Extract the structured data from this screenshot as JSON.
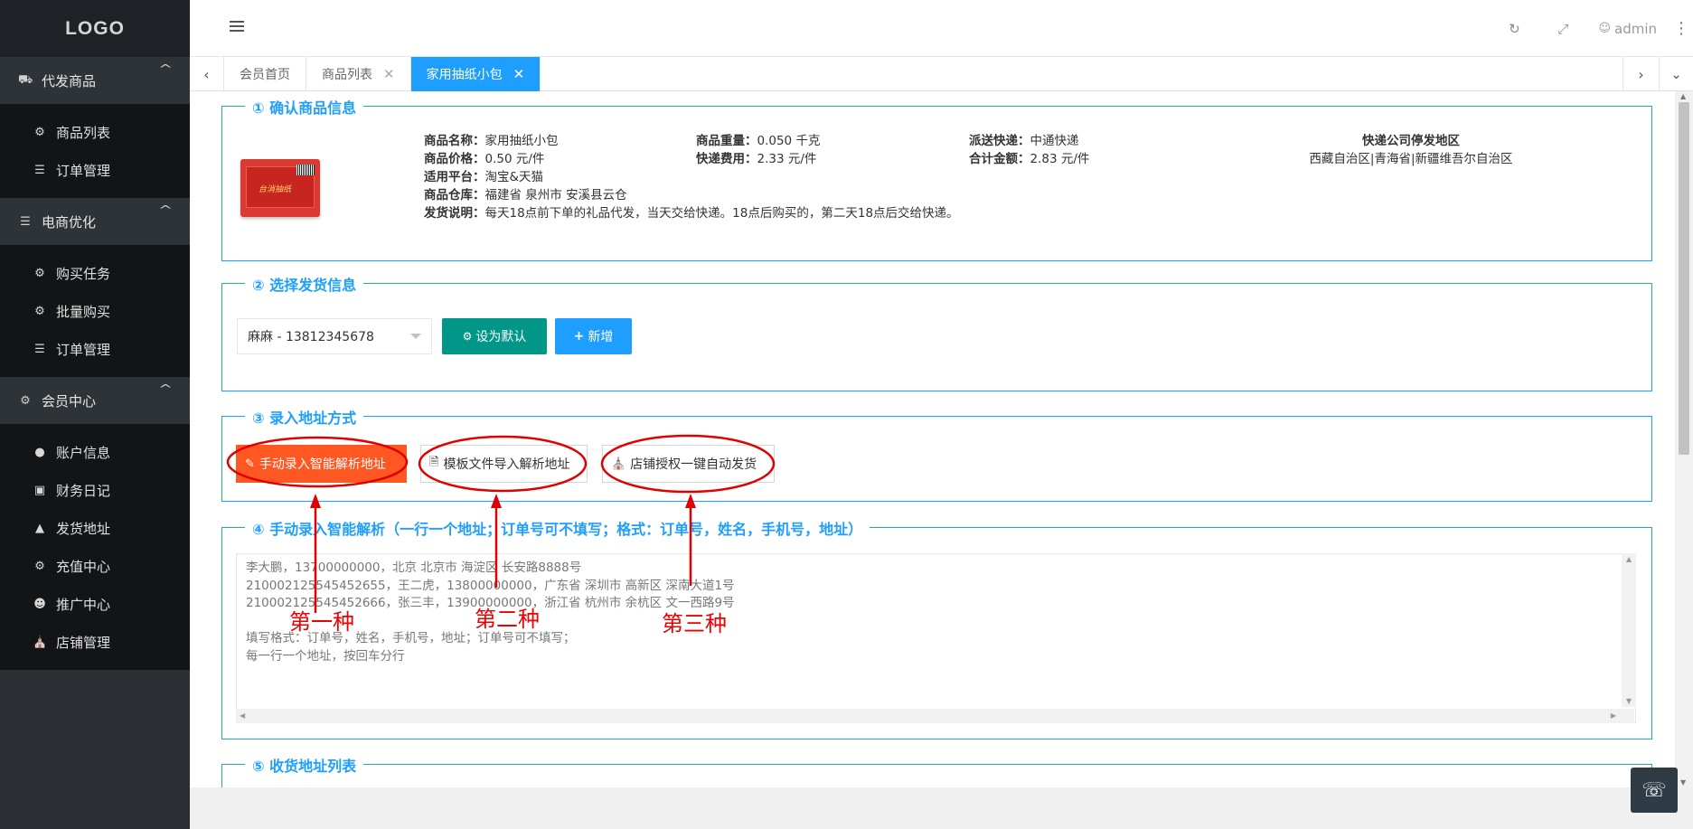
{
  "logo": "LOGO",
  "topbar": {
    "user": "admin"
  },
  "sidebar": {
    "groups": [
      {
        "label": "代发商品",
        "items": [
          {
            "label": "商品列表"
          },
          {
            "label": "订单管理"
          }
        ]
      },
      {
        "label": "电商优化",
        "items": [
          {
            "label": "购买任务"
          },
          {
            "label": "批量购买"
          },
          {
            "label": "订单管理"
          }
        ]
      },
      {
        "label": "会员中心",
        "items": [
          {
            "label": "账户信息"
          },
          {
            "label": "财务日记"
          },
          {
            "label": "发货地址"
          },
          {
            "label": "充值中心"
          },
          {
            "label": "推广中心"
          },
          {
            "label": "店铺管理"
          }
        ]
      }
    ]
  },
  "tabs": [
    {
      "label": "会员首页"
    },
    {
      "label": "商品列表"
    },
    {
      "label": "家用抽纸小包"
    }
  ],
  "section1": {
    "legend": "① 确认商品信息",
    "product_image_text": "台消抽纸",
    "name_label": "商品名称：",
    "name_value": "家用抽纸小包",
    "price_label": "商品价格：",
    "price_value": "0.50 元/件",
    "platform_label": "适用平台：",
    "platform_value": "淘宝&天猫",
    "warehouse_label": "商品仓库：",
    "warehouse_value": "福建省 泉州市 安溪县云仓",
    "ship_note_label": "发货说明：",
    "ship_note_value": "每天18点前下单的礼品代发，当天交给快递。18点后购买的，第二天18点后交给快递。",
    "weight_label": "商品重量：",
    "weight_value": "0.050 千克",
    "fee_label": "快递费用：",
    "fee_value": "2.33 元/件",
    "courier_label": "派送快递：",
    "courier_value": "中通快递",
    "total_label": "合计金额：",
    "total_value": "2.83 元/件",
    "stop_area_title": "快递公司停发地区",
    "stop_area_value": "西藏自治区|青海省|新疆维吾尔自治区"
  },
  "section2": {
    "legend": "② 选择发货信息",
    "selected_address": "麻麻 - 13812345678",
    "set_default": "设为默认",
    "add_new": "新增"
  },
  "section3": {
    "legend": "③ 录入地址方式",
    "btn_manual": "手动录入智能解析地址",
    "btn_template": "模板文件导入解析地址",
    "btn_shop": "店铺授权一键自动发货"
  },
  "section4": {
    "legend": "④ 手动录入智能解析（一行一个地址；订单号可不填写；格式：订单号，姓名，手机号，地址）",
    "placeholder": "李大鹏，13700000000，北京 北京市 海淀区 长安路8888号\n210002125545452655，王二虎，13800000000，广东省 深圳市 高新区 深南大道1号\n210002125545452666，张三丰，13900000000，浙江省 杭州市 余杭区 文一西路9号\n\n填写格式：订单号，姓名，手机号，地址；订单号可不填写；\n每一行一个地址，按回车分行"
  },
  "section5": {
    "legend": "⑤ 收货地址列表"
  },
  "annotations": {
    "first": "第一种",
    "second": "第二种",
    "third": "第三种",
    "color": "#e00000"
  }
}
